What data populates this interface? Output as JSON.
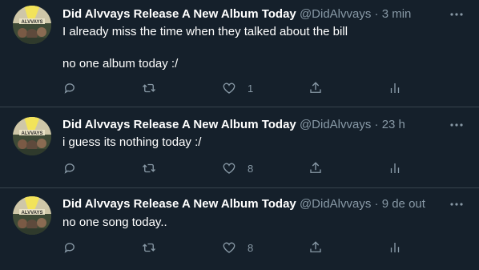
{
  "tweets": [
    {
      "name": "Did Alvvays Release A New Album Today",
      "handle": "@DidAlvvays",
      "dot": "·",
      "time": "3 min",
      "text": "I already miss the time when they talked about the bill\n\nno one album today :/",
      "like_count": "1"
    },
    {
      "name": "Did Alvvays Release A New Album Today",
      "handle": "@DidAlvvays",
      "dot": "·",
      "time": "23 h",
      "text": "i guess its nothing today :/",
      "like_count": "8"
    },
    {
      "name": "Did Alvvays Release A New Album Today",
      "handle": "@DidAlvvays",
      "dot": "·",
      "time": "9 de out",
      "text": "no one song today..",
      "like_count": "8"
    }
  ],
  "icons": {
    "reply": "reply-icon",
    "retweet": "retweet-icon",
    "like": "heart-icon",
    "share": "share-icon",
    "analytics": "analytics-icon",
    "more": "more-icon"
  },
  "colors": {
    "background": "#15202b",
    "secondary_text": "#8899a6",
    "divider": "#38444d"
  }
}
